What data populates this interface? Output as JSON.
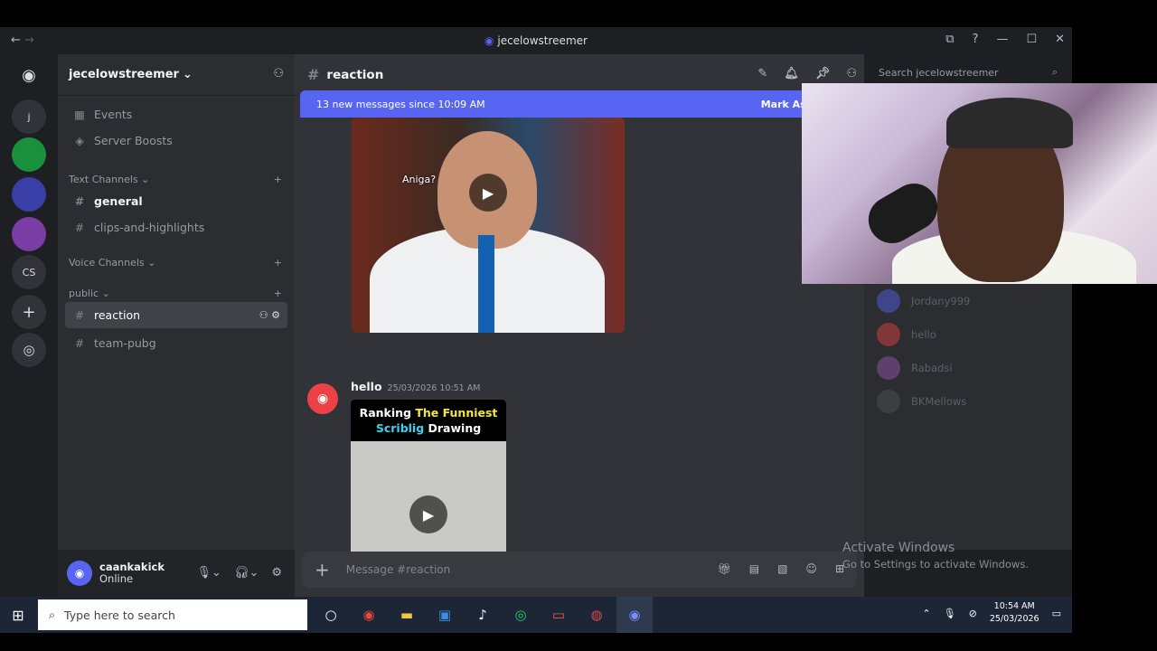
{
  "titlebar": {
    "title": "jecelowstreemer",
    "back": "←",
    "forward": "→",
    "inbox_icon": "⧉",
    "help_icon": "?",
    "minimize": "—",
    "maximize": "☐",
    "close": "✕"
  },
  "guilds": {
    "home": "◉",
    "items": [
      "j",
      "",
      "",
      "",
      "CS"
    ],
    "add": "+",
    "explore": "◎"
  },
  "server": {
    "name": "jecelowstreemer",
    "events": "Events",
    "boosts": "Server Boosts"
  },
  "categories": {
    "text": "Text Channels",
    "voice": "Voice Channels",
    "public": "public"
  },
  "channels": {
    "general": "general",
    "clips": "clips-and-highlights",
    "reaction": "reaction",
    "pubg": "team-pubg"
  },
  "user": {
    "name": "caankakick",
    "status": "Online"
  },
  "channel_header": {
    "name": "reaction"
  },
  "banner": {
    "text": "13 new messages since 10:09 AM",
    "action": "Mark As Re..."
  },
  "media1": {
    "caption": "Aniga?"
  },
  "message": {
    "author": "hello",
    "time": "25/03/2026 10:51 AM"
  },
  "thumb": {
    "line1a": "Ranking ",
    "line1b": "The Funniest",
    "line2a": "Scriblig ",
    "line2b": "Drawing"
  },
  "composer": {
    "placeholder": "Message #reaction"
  },
  "search": {
    "placeholder": "Search jecelowstreemer"
  },
  "members": [
    "Jordany999",
    "hello",
    "Rabadsi",
    "BKMellows"
  ],
  "watermark": {
    "title": "Activate Windows",
    "subtitle": "Go to Settings to activate Windows."
  },
  "taskbar": {
    "search_placeholder": "Type here to search",
    "time": "10:54 AM",
    "date": "25/03/2026"
  }
}
